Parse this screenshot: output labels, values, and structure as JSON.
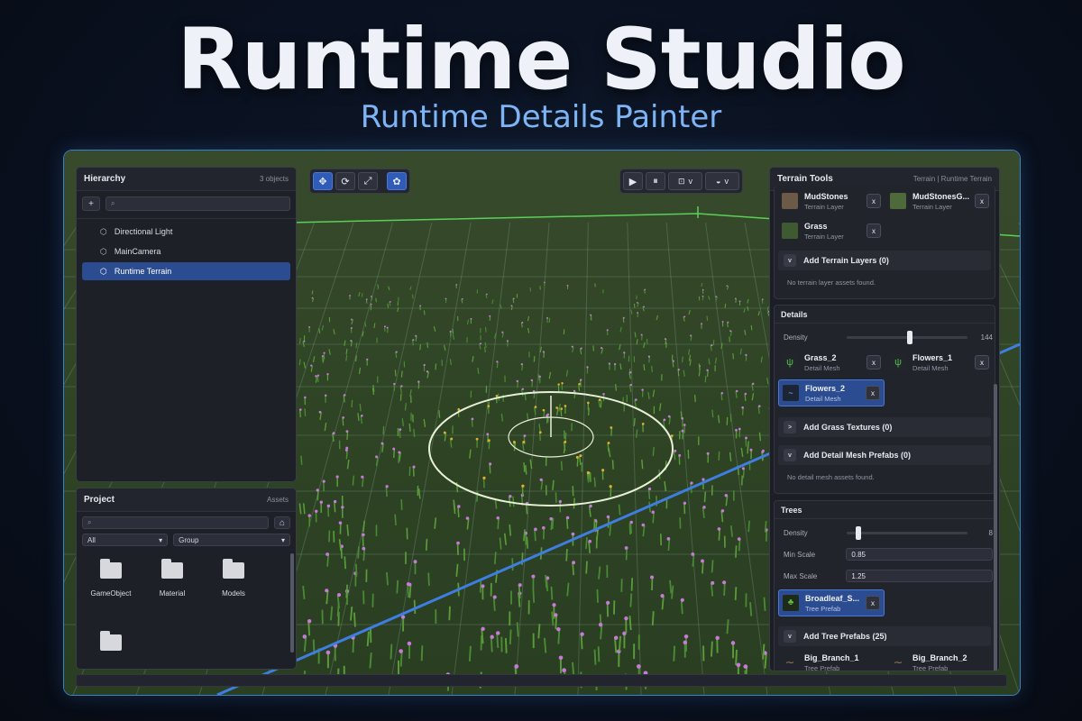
{
  "hero": {
    "title": "Runtime Studio",
    "subtitle": "Runtime Details Painter"
  },
  "toolbar_left": [
    {
      "icon": "move-icon",
      "active": true
    },
    {
      "icon": "rotate-icon",
      "active": false
    },
    {
      "icon": "scale-icon",
      "active": false
    },
    {
      "icon": "paint-icon",
      "active": true
    }
  ],
  "toolbar_right": [
    {
      "icon": "play-icon"
    },
    {
      "icon": "pause-icon"
    },
    {
      "icon": "pivot-icon",
      "chevron": "v"
    },
    {
      "icon": "sphere-icon",
      "chevron": "v"
    }
  ],
  "hierarchy": {
    "title": "Hierarchy",
    "count": "3 objects",
    "add_label": "+",
    "items": [
      {
        "label": "Directional Light",
        "selected": false
      },
      {
        "label": "MainCamera",
        "selected": false
      },
      {
        "label": "Runtime Terrain",
        "selected": true
      }
    ]
  },
  "project": {
    "title": "Project",
    "subtitle": "Assets",
    "filter_value": "All",
    "group_value": "Group",
    "folders": [
      "GameObject",
      "Material",
      "Models",
      ""
    ]
  },
  "terrain_tools": {
    "title": "Terrain Tools",
    "breadcrumb": "Terrain | Runtime Terrain",
    "layers": [
      {
        "name": "MudStones",
        "type": "Terrain Layer",
        "color": "#6b5a48"
      },
      {
        "name": "MudStonesG...",
        "type": "Terrain Layer",
        "color": "#4f6a3a"
      },
      {
        "name": "Grass",
        "type": "Terrain Layer",
        "color": "#3f5a30"
      }
    ],
    "add_layers": {
      "chevron": "v",
      "label": "Add Terrain Layers (0)"
    },
    "no_layers": "No terrain layer assets found.",
    "details": {
      "title": "Details",
      "density_label": "Density",
      "density_value": "144",
      "density_fraction": 0.52,
      "items": [
        {
          "name": "Grass_2",
          "type": "Detail Mesh",
          "selected": false,
          "color": "#3f8f3a"
        },
        {
          "name": "Flowers_1",
          "type": "Detail Mesh",
          "selected": false,
          "color": "#3f8f3a"
        },
        {
          "name": "Flowers_2",
          "type": "Detail Mesh",
          "selected": true,
          "color": "#2a3f5a"
        }
      ],
      "add_grass": {
        "chevron": ">",
        "label": "Add Grass Textures (0)"
      },
      "add_mesh": {
        "chevron": "v",
        "label": "Add Detail Mesh Prefabs (0)"
      },
      "no_mesh": "No detail mesh assets found."
    },
    "trees": {
      "title": "Trees",
      "density_label": "Density",
      "density_value": "8",
      "density_fraction": 0.08,
      "min_scale_label": "Min Scale",
      "min_scale_value": "0.85",
      "max_scale_label": "Max Scale",
      "max_scale_value": "1.25",
      "selected_item": {
        "name": "Broadleaf_S...",
        "type": "Tree Prefab",
        "color": "#3c7a2a"
      },
      "add_trees": {
        "chevron": "v",
        "label": "Add Tree Prefabs (25)"
      },
      "prefabs": [
        {
          "name": "Big_Branch_1",
          "type": "Tree Prefab"
        },
        {
          "name": "Big_Branch_2",
          "type": "Tree Prefab"
        }
      ]
    },
    "x_label": "x"
  },
  "colors": {
    "accent": "#2f5cb8",
    "selection": "#2c4c91",
    "frame_border": "#3d7fc4",
    "subtitle": "#7db4f5",
    "terrain_green": "#3c5c2a",
    "flower_pink": "#c77ad8",
    "flower_yellow": "#e0b030",
    "brush_ring": "#e8f0d8",
    "terrain_edge": "#5ad05a",
    "axis_blue": "#3f7de0"
  }
}
